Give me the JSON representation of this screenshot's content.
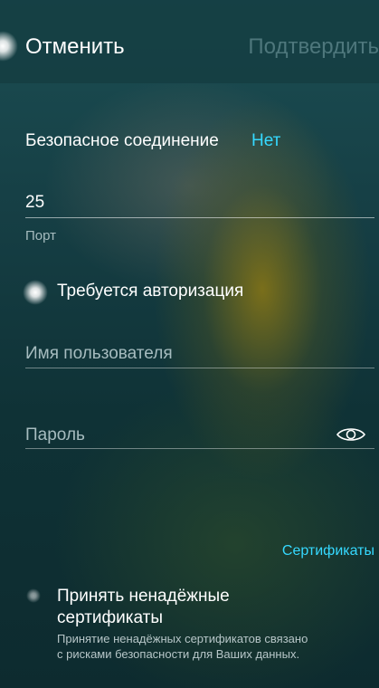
{
  "header": {
    "cancel_label": "Отменить",
    "confirm_label": "Подтвердить"
  },
  "secure_connection": {
    "label": "Безопасное соединение",
    "value": "Нет"
  },
  "port": {
    "value": "25",
    "label": "Порт"
  },
  "auth": {
    "label": "Требуется авторизация",
    "enabled": true
  },
  "username": {
    "placeholder": "Имя пользователя"
  },
  "password": {
    "placeholder": "Пароль",
    "visibility_icon": "eye-icon"
  },
  "certificates": {
    "link_label": "Сертификаты"
  },
  "untrusted_certs": {
    "title": "Принять ненадёжные сертификаты",
    "description": "Принятие ненадёжных сертификатов связано с рисками безопасности для Ваших данных.",
    "enabled": false
  },
  "colors": {
    "accent": "#35d9ff",
    "background": "#163f45",
    "secondary_text": "#a6bcbf"
  }
}
